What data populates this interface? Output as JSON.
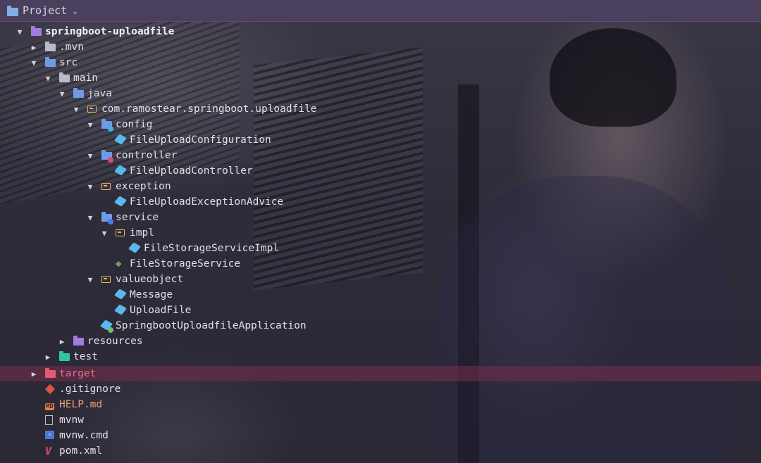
{
  "header": {
    "title": "Project",
    "chevron_icon": "chevron-down-icon"
  },
  "tree": {
    "root": "springboot-uploadfile",
    "mvn": ".mvn",
    "src": "src",
    "main": "main",
    "java": "java",
    "package": "com.ramostear.springboot.uploadfile",
    "config": "config",
    "file_upload_configuration": "FileUploadConfiguration",
    "controller": "controller",
    "file_upload_controller": "FileUploadController",
    "exception": "exception",
    "file_upload_exception_advice": "FileUploadExceptionAdvice",
    "service": "service",
    "impl": "impl",
    "file_storage_service_impl": "FileStorageServiceImpl",
    "file_storage_service": "FileStorageService",
    "valueobject": "valueobject",
    "message": "Message",
    "upload_file": "UploadFile",
    "application": "SpringbootUploadfileApplication",
    "resources": "resources",
    "test": "test",
    "target": "target",
    "gitignore": ".gitignore",
    "help_md": "HELP.md",
    "mvnw": "mvnw",
    "mvnw_cmd": "mvnw.cmd",
    "pom": "pom.xml"
  },
  "colors": {
    "titlebar": "#4b3f5e",
    "selection": "#7a2d4b",
    "text": "#e2dfea",
    "excluded": "#e0708c",
    "class_icon": "#59b8ee",
    "package_icon": "#e7b75a"
  }
}
